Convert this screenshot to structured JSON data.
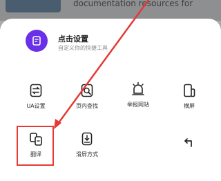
{
  "background": {
    "headline": "documentation resources for"
  },
  "app": {
    "title": "点击设置",
    "subtitle": "自定义你的快捷工具"
  },
  "tools": [
    {
      "label": "UA设置",
      "icon": "ua-settings-icon"
    },
    {
      "label": "页内查找",
      "icon": "find-in-page-icon"
    },
    {
      "label": "举报网站",
      "icon": "report-site-icon"
    },
    {
      "label": "横屏",
      "icon": "landscape-icon"
    },
    {
      "label": "翻译",
      "icon": "translate-icon"
    },
    {
      "label": "滑屏方式",
      "icon": "swipe-mode-icon"
    },
    {
      "label": "",
      "icon": "back-arrow-icon"
    }
  ],
  "colors": {
    "accent": "#6a2fe8",
    "annotation": "#e53935"
  }
}
